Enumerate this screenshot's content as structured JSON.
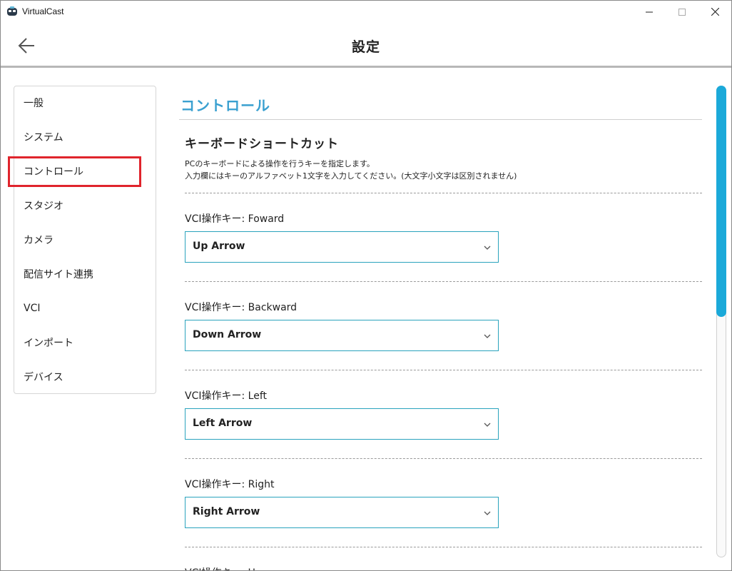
{
  "window": {
    "title": "VirtualCast",
    "controls": [
      "minimize-icon",
      "maximize-icon",
      "close-icon"
    ]
  },
  "header": {
    "title": "設定",
    "back_icon": "arrow-left-icon"
  },
  "sidebar": {
    "items": [
      {
        "label": "一般"
      },
      {
        "label": "システム"
      },
      {
        "label": "コントロール",
        "selected": true
      },
      {
        "label": "スタジオ"
      },
      {
        "label": "カメラ"
      },
      {
        "label": "配信サイト連携"
      },
      {
        "label": "VCI"
      },
      {
        "label": "インポート"
      },
      {
        "label": "デバイス"
      }
    ]
  },
  "main": {
    "section_title": "コントロール",
    "subsection_title": "キーボードショートカット",
    "description_line1": "PCのキーボードによる操作を行うキーを指定します。",
    "description_line2": "入力欄にはキーのアルファベット1文字を入力してください。(大文字小文字は区別されません)",
    "fields": [
      {
        "label": "VCI操作キー: Foward",
        "value": "Up Arrow"
      },
      {
        "label": "VCI操作キー: Backward",
        "value": "Down Arrow"
      },
      {
        "label": "VCI操作キー: Left",
        "value": "Left Arrow"
      },
      {
        "label": "VCI操作キー: Right",
        "value": "Right Arrow"
      },
      {
        "label": "VCI操作キー: Up"
      }
    ]
  },
  "colors": {
    "accent": "#3aa0d0",
    "select_border": "#2aa3bd",
    "scroll_thumb": "#1ba9d9",
    "highlight_box": "#e0242c"
  }
}
